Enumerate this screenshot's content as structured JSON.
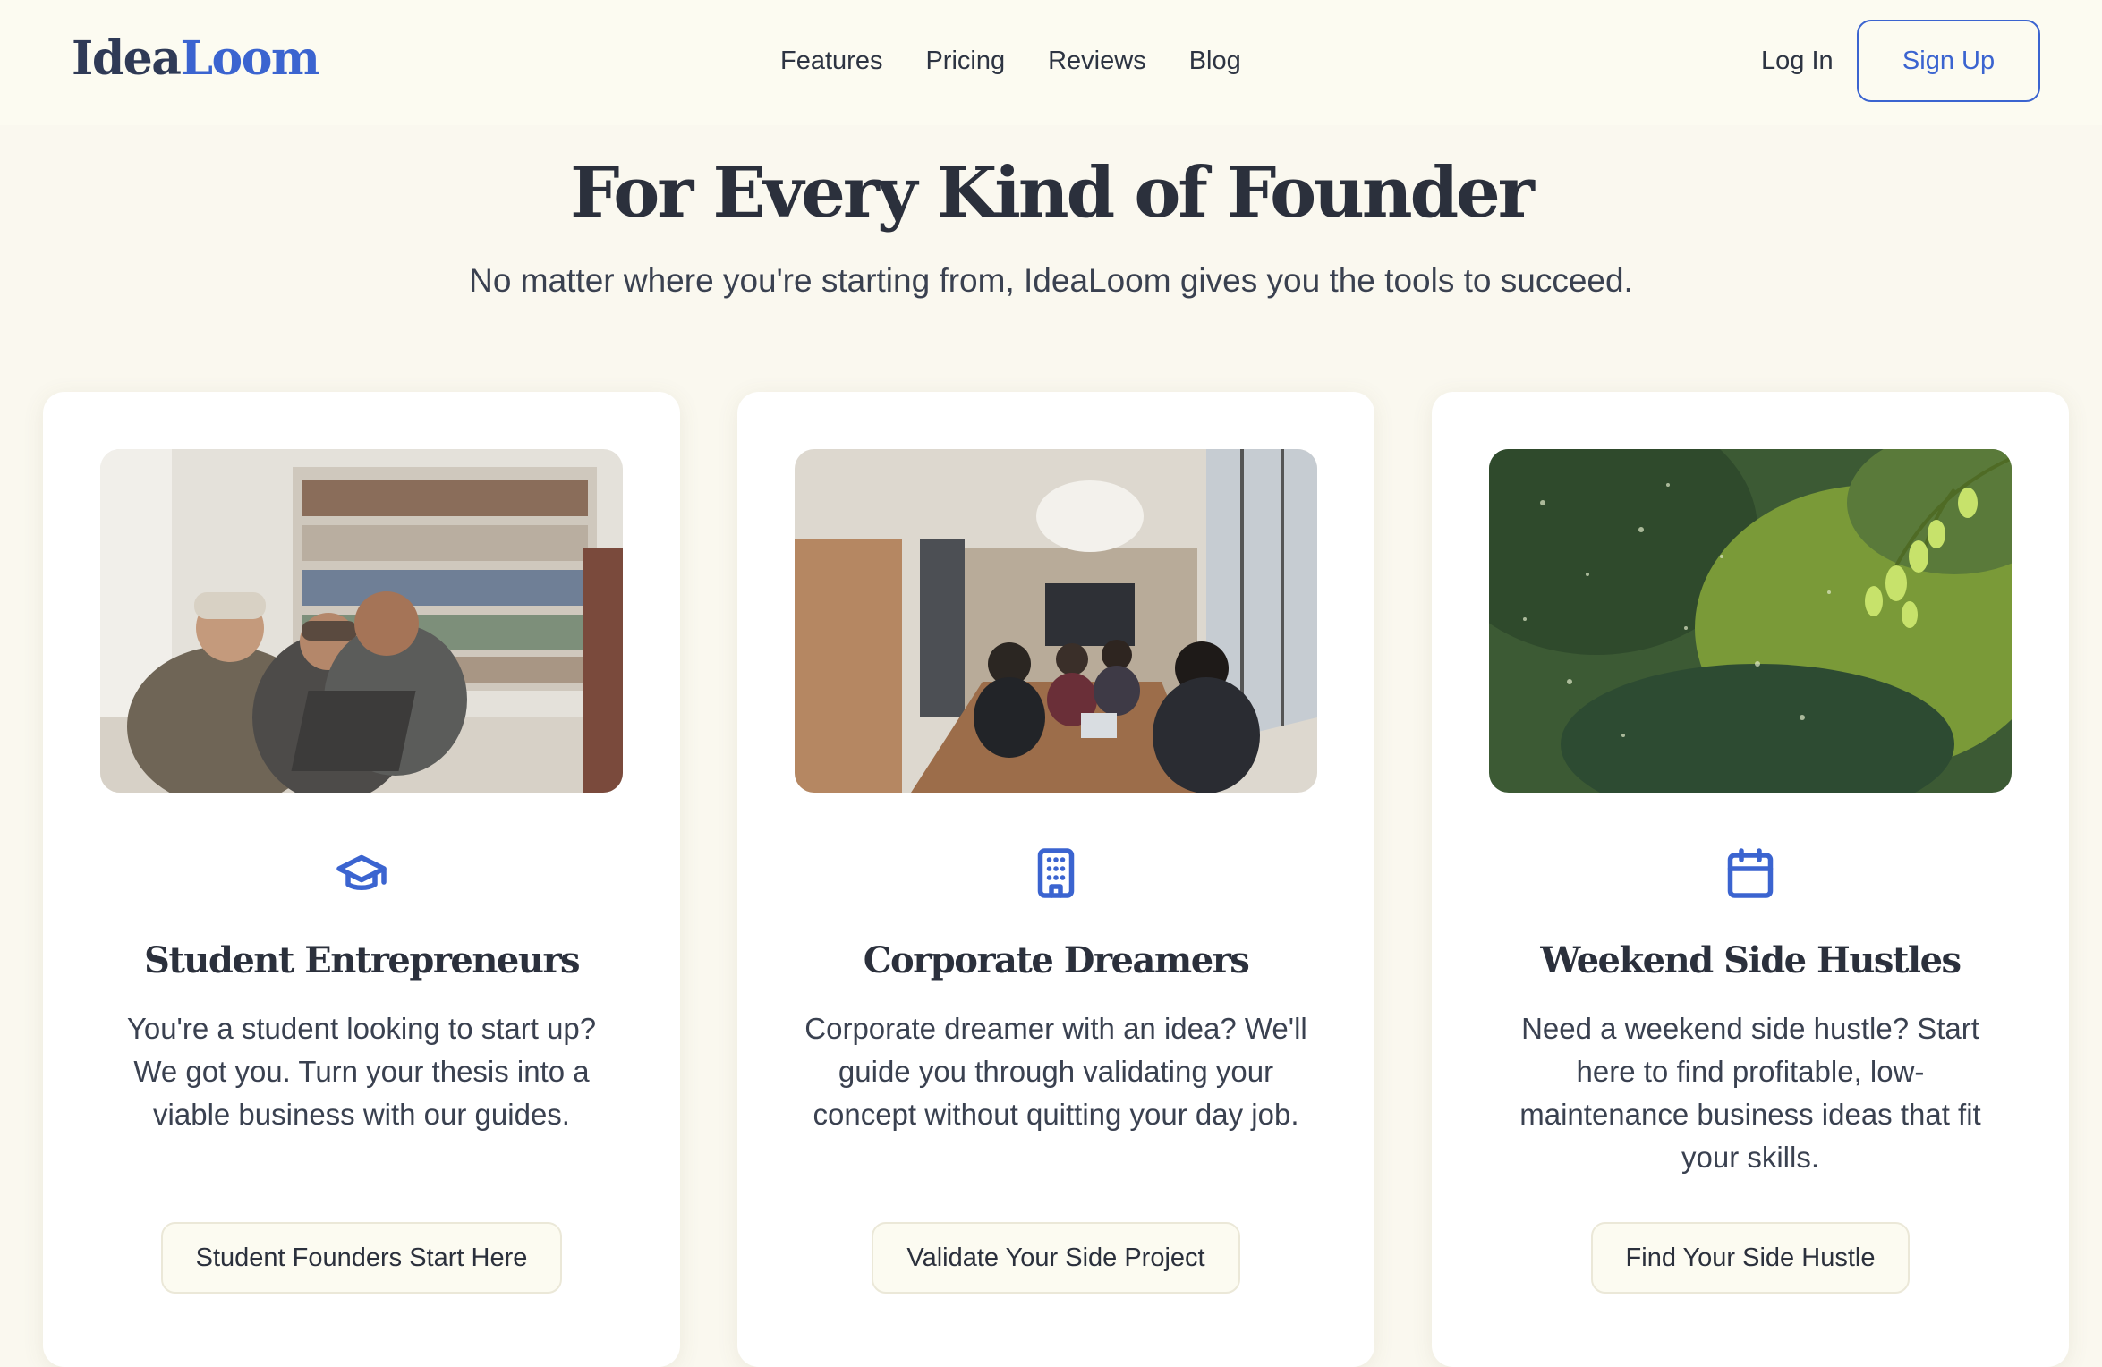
{
  "header": {
    "logo_part1": "Idea",
    "logo_part2": "Loom",
    "nav": [
      "Features",
      "Pricing",
      "Reviews",
      "Blog"
    ],
    "login_label": "Log In",
    "signup_label": "Sign Up"
  },
  "hero": {
    "title": "For Every Kind of Founder",
    "subtitle": "No matter where you're starting from, IdeaLoom gives you the tools to succeed."
  },
  "cards": [
    {
      "icon": "graduation-cap-icon",
      "title": "Student Entrepreneurs",
      "description": "You're a student looking to start up? We got you. Turn your thesis into a viable business with our guides.",
      "button": "Student Founders Start Here"
    },
    {
      "icon": "building-icon",
      "title": "Corporate Dreamers",
      "description": "Corporate dreamer with an idea? We'll guide you through validating your concept without quitting your day job.",
      "button": "Validate Your Side Project"
    },
    {
      "icon": "calendar-icon",
      "title": "Weekend Side Hustles",
      "description": "Need a weekend side hustle? Start here to find profitable, low-maintenance business ideas that fit your skills.",
      "button": "Find Your Side Hustle"
    }
  ],
  "colors": {
    "accent": "#3b64d0",
    "background": "#faf8ef",
    "text": "#2d3442"
  }
}
